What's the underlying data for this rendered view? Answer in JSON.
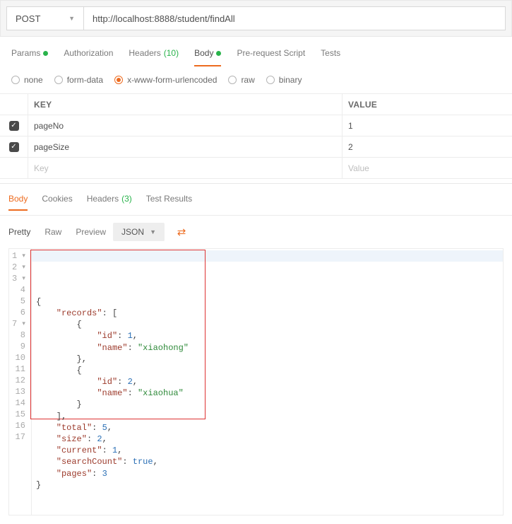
{
  "request": {
    "method": "POST",
    "url": "http://localhost:8888/student/findAll"
  },
  "requestTabs": {
    "params": "Params",
    "authorization": "Authorization",
    "headers": "Headers",
    "headersCount": "(10)",
    "body": "Body",
    "prescript": "Pre-request Script",
    "tests": "Tests"
  },
  "bodyOptions": {
    "none": "none",
    "formData": "form-data",
    "urlencoded": "x-www-form-urlencoded",
    "raw": "raw",
    "binary": "binary"
  },
  "kvHeaders": {
    "key": "KEY",
    "value": "VALUE"
  },
  "rows": [
    {
      "key": "pageNo",
      "value": "1"
    },
    {
      "key": "pageSize",
      "value": "2"
    }
  ],
  "placeholder": {
    "key": "Key",
    "value": "Value"
  },
  "responseTabs": {
    "body": "Body",
    "cookies": "Cookies",
    "headers": "Headers",
    "headersCount": "(3)",
    "testResults": "Test Results"
  },
  "formatBar": {
    "pretty": "Pretty",
    "raw": "Raw",
    "preview": "Preview",
    "json": "JSON"
  },
  "responseJson": {
    "records": [
      {
        "id": 1,
        "name": "xiaohong"
      },
      {
        "id": 2,
        "name": "xiaohua"
      }
    ],
    "total": 5,
    "size": 2,
    "current": 1,
    "searchCount": true,
    "pages": 3
  },
  "lineNumbers": [
    "1",
    "2",
    "3",
    "4",
    "5",
    "6",
    "7",
    "8",
    "9",
    "10",
    "11",
    "12",
    "13",
    "14",
    "15",
    "16",
    "17"
  ]
}
